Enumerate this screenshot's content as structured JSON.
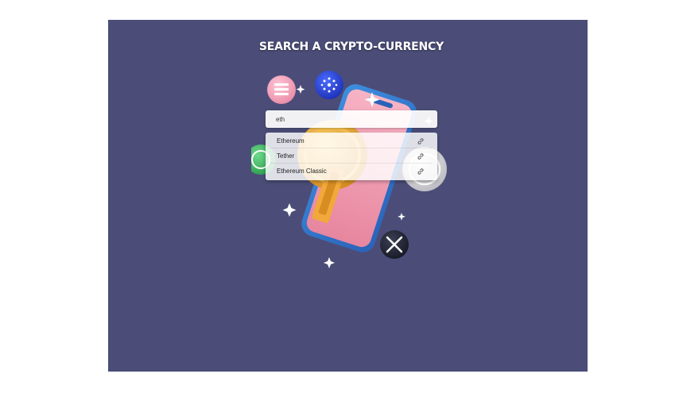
{
  "title": "SEARCH A CRYPTO-CURRENCY",
  "search": {
    "value": "eth",
    "placeholder": ""
  },
  "results": [
    {
      "label": "Ethereum",
      "icon": "link-icon"
    },
    {
      "label": "Tether",
      "icon": "link-icon"
    },
    {
      "label": "Ethereum Classic",
      "icon": "link-icon"
    }
  ],
  "colors": {
    "background": "#4b4d78",
    "page": "#ffffff"
  }
}
